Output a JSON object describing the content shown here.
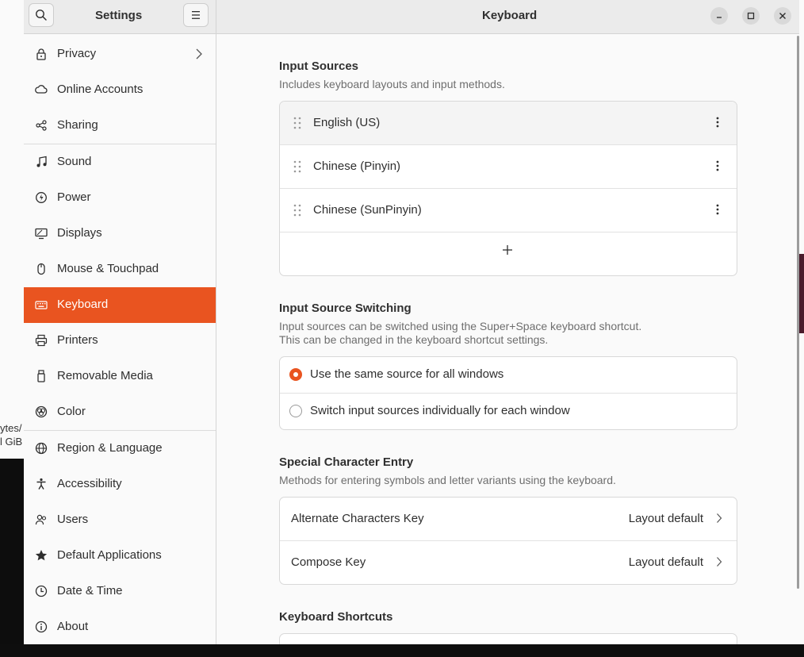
{
  "background": {
    "fragment_1": "ytes/",
    "fragment_2": "l GiB"
  },
  "header": {
    "sidebar_title": "Settings",
    "page_title": "Keyboard"
  },
  "sidebar": {
    "items": [
      {
        "label": "Privacy",
        "icon": "lock-icon"
      },
      {
        "label": "Online Accounts",
        "icon": "cloud-icon"
      },
      {
        "label": "Sharing",
        "icon": "share-icon"
      },
      {
        "label": "Sound",
        "icon": "music-note-icon"
      },
      {
        "label": "Power",
        "icon": "power-icon"
      },
      {
        "label": "Displays",
        "icon": "display-icon"
      },
      {
        "label": "Mouse & Touchpad",
        "icon": "mouse-icon"
      },
      {
        "label": "Keyboard",
        "icon": "keyboard-icon"
      },
      {
        "label": "Printers",
        "icon": "printer-icon"
      },
      {
        "label": "Removable Media",
        "icon": "usb-drive-icon"
      },
      {
        "label": "Color",
        "icon": "color-icon"
      },
      {
        "label": "Region & Language",
        "icon": "globe-icon"
      },
      {
        "label": "Accessibility",
        "icon": "accessibility-icon"
      },
      {
        "label": "Users",
        "icon": "users-icon"
      },
      {
        "label": "Default Applications",
        "icon": "star-icon"
      },
      {
        "label": "Date & Time",
        "icon": "clock-icon"
      },
      {
        "label": "About",
        "icon": "info-icon"
      }
    ],
    "active": "Keyboard"
  },
  "input_sources": {
    "title": "Input Sources",
    "description": "Includes keyboard layouts and input methods.",
    "items": [
      "English (US)",
      "Chinese (Pinyin)",
      "Chinese (SunPinyin)"
    ]
  },
  "switching": {
    "title": "Input Source Switching",
    "description_line1": "Input sources can be switched using the Super+Space keyboard shortcut.",
    "description_line2": "This can be changed in the keyboard shortcut settings.",
    "options": [
      "Use the same source for all windows",
      "Switch input sources individually for each window"
    ],
    "selected": "Use the same source for all windows"
  },
  "special_chars": {
    "title": "Special Character Entry",
    "description": "Methods for entering symbols and letter variants using the keyboard.",
    "rows": [
      {
        "label": "Alternate Characters Key",
        "value": "Layout default"
      },
      {
        "label": "Compose Key",
        "value": "Layout default"
      }
    ]
  },
  "shortcuts": {
    "title": "Keyboard Shortcuts"
  },
  "colors": {
    "accent": "#e95420"
  }
}
